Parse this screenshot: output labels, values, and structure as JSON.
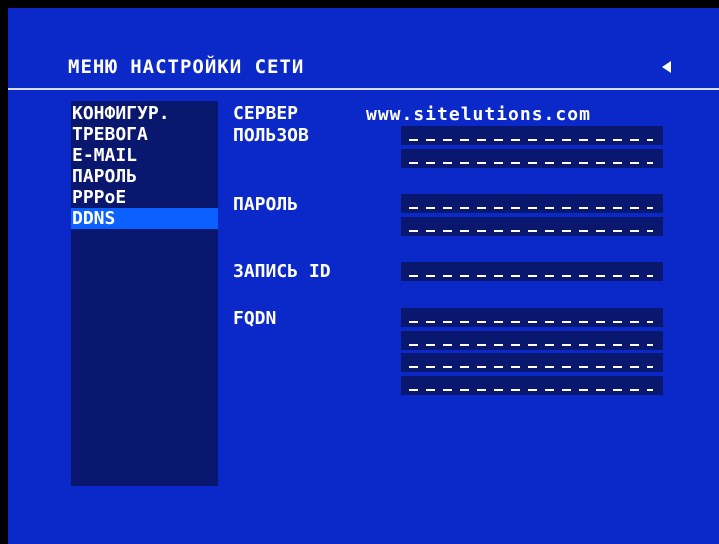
{
  "menu": {
    "title": "МЕНЮ НАСТРОЙКИ СЕТИ"
  },
  "sidebar": {
    "items": [
      {
        "label": "КОНФИГУР."
      },
      {
        "label": "ТРЕВОГА"
      },
      {
        "label": "E-MAIL"
      },
      {
        "label": "ПАРОЛЬ"
      },
      {
        "label": "PPPoE"
      },
      {
        "label": "DDNS",
        "selected": true
      }
    ]
  },
  "ddns": {
    "server_label": "СЕРВЕР",
    "server_value": "www.sitelutions.com",
    "user_label": "ПОЛЬЗОВ",
    "password_label": "ПАРОЛЬ",
    "record_id_label": "ЗАПИСЬ ID",
    "fqdn_label": "FQDN"
  },
  "colors": {
    "screen_bg": "#0b28c8",
    "panel_bg": "#0a176f",
    "selection": "#0b60ff",
    "text": "#ffffff"
  },
  "icons": {
    "back": "back-arrow-icon"
  }
}
